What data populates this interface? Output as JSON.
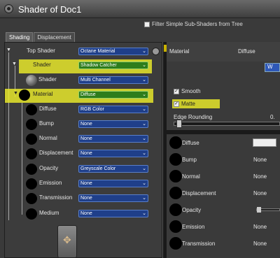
{
  "window": {
    "title": "Shader of Doc1"
  },
  "filter": {
    "label": "Filter Simple Sub-Shaders from Tree",
    "checked": false
  },
  "tabs": [
    {
      "label": "Shading",
      "active": true
    },
    {
      "label": "Displacement",
      "active": false
    }
  ],
  "tree": [
    {
      "label": "Top Shader",
      "value": "Octane Material",
      "icon": "none"
    },
    {
      "label": "Shader",
      "value": "Shadow Catcher",
      "highlight": true
    },
    {
      "label": "Shader",
      "value": "Multi Channel",
      "icon": "gray-ball"
    },
    {
      "label": "Material",
      "value": "Diffuse",
      "highlight": true,
      "icon": "black-ball"
    },
    {
      "label": "Diffuse",
      "value": "RGB Color",
      "icon": "black-ball"
    },
    {
      "label": "Bump",
      "value": "None",
      "icon": "black-ball"
    },
    {
      "label": "Normal",
      "value": "None",
      "icon": "black-ball"
    },
    {
      "label": "Displacement",
      "value": "None",
      "icon": "black-ball"
    },
    {
      "label": "Opacity",
      "value": "Greyscale Color",
      "icon": "black-ball"
    },
    {
      "label": "Emission",
      "value": "None",
      "icon": "black-ball"
    },
    {
      "label": "Transmission",
      "value": "None",
      "icon": "black-ball"
    },
    {
      "label": "Medium",
      "value": "None",
      "icon": "black-ball"
    }
  ],
  "right": {
    "header_left": "Material",
    "header_right": "Diffuse",
    "button_label": "W",
    "smooth_label": "Smooth",
    "matte_label": "Matte",
    "edge_label": "Edge Rounding",
    "edge_value": "0.",
    "props": [
      {
        "label": "Diffuse",
        "value": ""
      },
      {
        "label": "Bump",
        "value": "None"
      },
      {
        "label": "Normal",
        "value": "None"
      },
      {
        "label": "Displacement",
        "value": "None"
      },
      {
        "label": "Opacity",
        "value": ""
      },
      {
        "label": "Emission",
        "value": "None"
      },
      {
        "label": "Transmission",
        "value": "None"
      }
    ]
  },
  "colors": {
    "highlight": "#e6e62a",
    "dropdown_blue": "#1f3f8a",
    "dropdown_green": "#2e7d1c"
  }
}
